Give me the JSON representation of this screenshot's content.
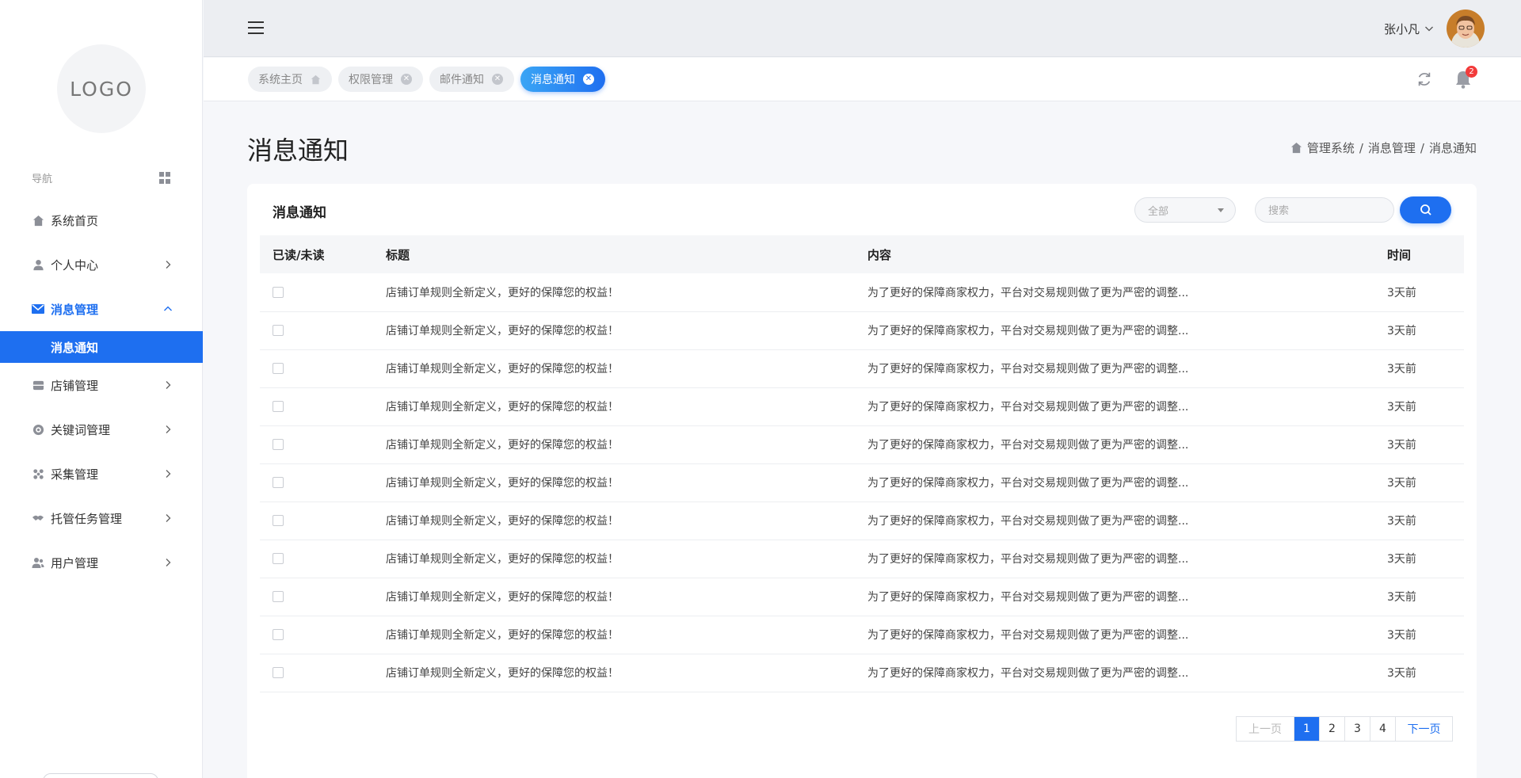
{
  "sidebar": {
    "logo_text": "LOGO",
    "nav_heading": "导航",
    "items": [
      {
        "label": "系统首页",
        "icon": "home-icon"
      },
      {
        "label": "个人中心",
        "icon": "user-icon"
      },
      {
        "label": "消息管理",
        "icon": "mail-icon",
        "active": true
      },
      {
        "label": "店铺管理",
        "icon": "store-icon"
      },
      {
        "label": "关键词管理",
        "icon": "target-icon"
      },
      {
        "label": "采集管理",
        "icon": "apps-icon"
      },
      {
        "label": "托管任务管理",
        "icon": "handshake-icon"
      },
      {
        "label": "用户管理",
        "icon": "users-icon"
      }
    ],
    "active_sub_label": "消息通知"
  },
  "header": {
    "username": "张小凡",
    "notification_count": "2"
  },
  "tabs": [
    {
      "label": "系统主页",
      "icon": "home-icon"
    },
    {
      "label": "权限管理"
    },
    {
      "label": "邮件通知"
    },
    {
      "label": "消息通知",
      "active": true
    }
  ],
  "page": {
    "title": "消息通知",
    "breadcrumb": [
      "管理系统",
      "消息管理",
      "消息通知"
    ]
  },
  "card": {
    "title": "消息通知",
    "filter_selected": "全部",
    "search_placeholder": "搜索"
  },
  "table": {
    "columns": [
      "已读/未读",
      "标题",
      "内容",
      "时间"
    ],
    "rows": [
      {
        "title": "店铺订单规则全新定义，更好的保障您的权益！",
        "content": "为了更好的保障商家权力，平台对交易规则做了更为严密的调整...",
        "time": "3天前"
      },
      {
        "title": "店铺订单规则全新定义，更好的保障您的权益！",
        "content": "为了更好的保障商家权力，平台对交易规则做了更为严密的调整...",
        "time": "3天前"
      },
      {
        "title": "店铺订单规则全新定义，更好的保障您的权益！",
        "content": "为了更好的保障商家权力，平台对交易规则做了更为严密的调整...",
        "time": "3天前"
      },
      {
        "title": "店铺订单规则全新定义，更好的保障您的权益！",
        "content": "为了更好的保障商家权力，平台对交易规则做了更为严密的调整...",
        "time": "3天前"
      },
      {
        "title": "店铺订单规则全新定义，更好的保障您的权益！",
        "content": "为了更好的保障商家权力，平台对交易规则做了更为严密的调整...",
        "time": "3天前"
      },
      {
        "title": "店铺订单规则全新定义，更好的保障您的权益！",
        "content": "为了更好的保障商家权力，平台对交易规则做了更为严密的调整...",
        "time": "3天前"
      },
      {
        "title": "店铺订单规则全新定义，更好的保障您的权益！",
        "content": "为了更好的保障商家权力，平台对交易规则做了更为严密的调整...",
        "time": "3天前"
      },
      {
        "title": "店铺订单规则全新定义，更好的保障您的权益！",
        "content": "为了更好的保障商家权力，平台对交易规则做了更为严密的调整...",
        "time": "3天前"
      },
      {
        "title": "店铺订单规则全新定义，更好的保障您的权益！",
        "content": "为了更好的保障商家权力，平台对交易规则做了更为严密的调整...",
        "time": "3天前"
      },
      {
        "title": "店铺订单规则全新定义，更好的保障您的权益！",
        "content": "为了更好的保障商家权力，平台对交易规则做了更为严密的调整...",
        "time": "3天前"
      },
      {
        "title": "店铺订单规则全新定义，更好的保障您的权益！",
        "content": "为了更好的保障商家权力，平台对交易规则做了更为严密的调整...",
        "time": "3天前"
      }
    ]
  },
  "pagination": {
    "prev_label": "上一页",
    "next_label": "下一页",
    "pages": [
      "1",
      "2",
      "3",
      "4"
    ],
    "current": "1"
  },
  "colors": {
    "primary": "#1e6ff0",
    "badge": "#f23b3b"
  }
}
